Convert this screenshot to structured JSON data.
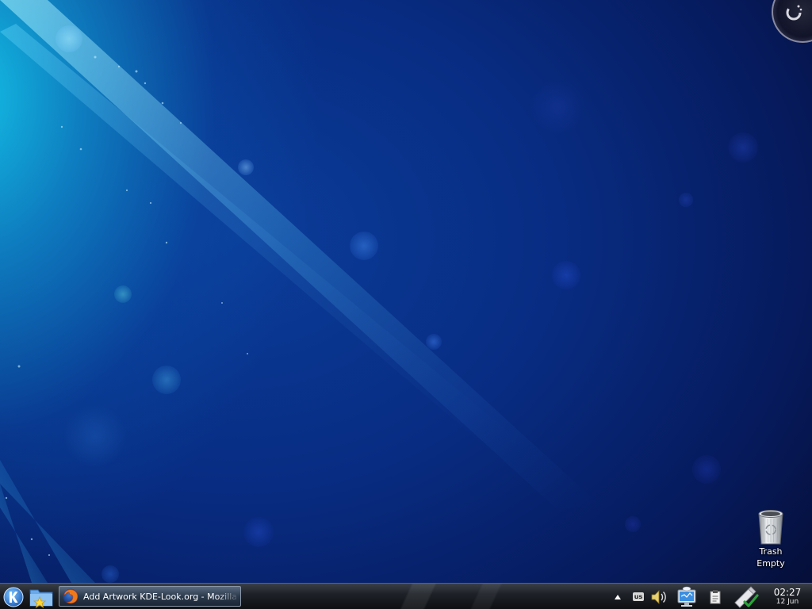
{
  "desktop": {
    "icons": [
      {
        "name": "Trash",
        "status": "Empty",
        "icon": "trash-icon"
      }
    ]
  },
  "panel": {
    "launcher_icon": "kde-logo-icon",
    "places_icon": "folder-star-icon",
    "tasks": [
      {
        "title": "Add Artwork KDE-Look.org - Mozilla Firefox",
        "icon": "firefox-icon"
      }
    ],
    "systray": {
      "expand_icon": "arrow-up-icon",
      "keyboard_layout": "us",
      "volume_icon": "speaker-icon",
      "network_icon": "network-monitor-icon",
      "clipboard_icon": "clipboard-icon",
      "update_icon": "update-notifier-icon"
    },
    "clock": {
      "time": "02:27",
      "date": "12 Jun"
    }
  },
  "colors": {
    "wallpaper_dark": "#050f3a",
    "wallpaper_mid": "#082c82",
    "wallpaper_light": "#14c8eb",
    "panel_bg": "#1e2228",
    "text": "#ffffff"
  }
}
